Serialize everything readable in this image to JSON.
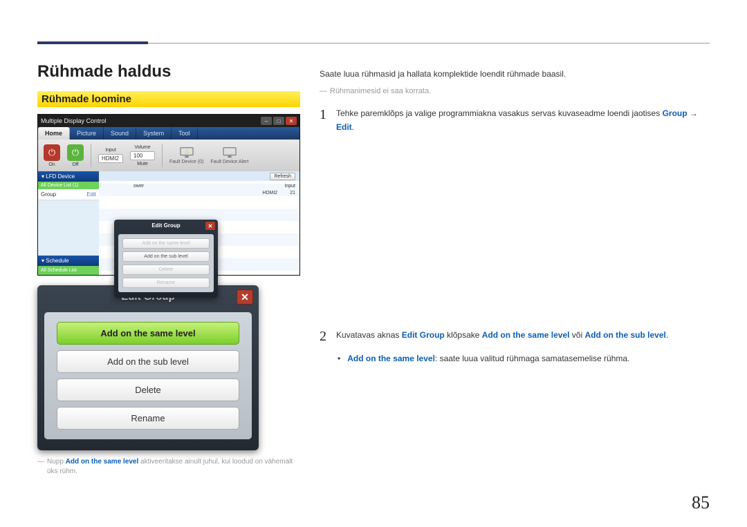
{
  "page_number": "85",
  "section_title": "Rühmade haldus",
  "subsection_title": "Rühmade loomine",
  "intro_text": "Saate luua rühmasid ja hallata komplektide loendit rühmade baasil.",
  "note_mark": "―",
  "note_text": "Rühmanimesid ei saa korrata.",
  "mdc": {
    "window_title": "Multiple Display Control",
    "tabs": {
      "home": "Home",
      "picture": "Picture",
      "sound": "Sound",
      "system": "System",
      "tool": "Tool"
    },
    "ribbon": {
      "on": "On",
      "off": "Off",
      "input_label": "Input",
      "input_value": "HDMI2",
      "volume_label": "Volume",
      "volume_value": "100",
      "mute": "Mute",
      "fault_device": "Fault Device (0)",
      "fault_alert": "Fault Device Alert"
    },
    "sidebar": {
      "lfd_header": "▾ LFD Device",
      "all_devices": "All Device List (1)",
      "group_label": "Group",
      "edit": "Edit",
      "schedule_header": "▾ Schedule",
      "all_schedule": "All Schedule List"
    },
    "grid": {
      "refresh": "Refresh",
      "col_power": "ower",
      "col_input": "Input",
      "row_input": "HDMI2",
      "row_num": "21"
    },
    "popup": {
      "title": "Edit Group",
      "opt_same": "Add on the same level",
      "opt_sub": "Add on the sub level",
      "opt_delete": "Delete",
      "opt_rename": "Rename"
    }
  },
  "dlg": {
    "title": "Edit Group",
    "opt_same": "Add on the same level",
    "opt_sub": "Add on the sub level",
    "opt_delete": "Delete",
    "opt_rename": "Rename"
  },
  "footnote": {
    "mark": "―",
    "pre": "Nupp ",
    "hl": "Add on the same level",
    "post": " aktiveeritakse ainult juhul, kui loodud on vähemalt üks rühm."
  },
  "step1": {
    "num": "1",
    "pre": "Tehke paremklõps ja valige programmiakna vasakus servas kuvaseadme loendi jaotises ",
    "kw1": "Group",
    "arrow": " → ",
    "kw2": "Edit",
    "end": "."
  },
  "step2": {
    "num": "2",
    "pre": "Kuvatavas aknas ",
    "kw_dlg": "Edit Group",
    "mid1": " klõpsake ",
    "kw_same": "Add on the same level",
    "mid2": " või ",
    "kw_sub": "Add on the sub level",
    "end": ".",
    "bullet_kw": "Add on the same level",
    "bullet_text": ": saate luua valitud rühmaga samatasemelise rühma."
  }
}
